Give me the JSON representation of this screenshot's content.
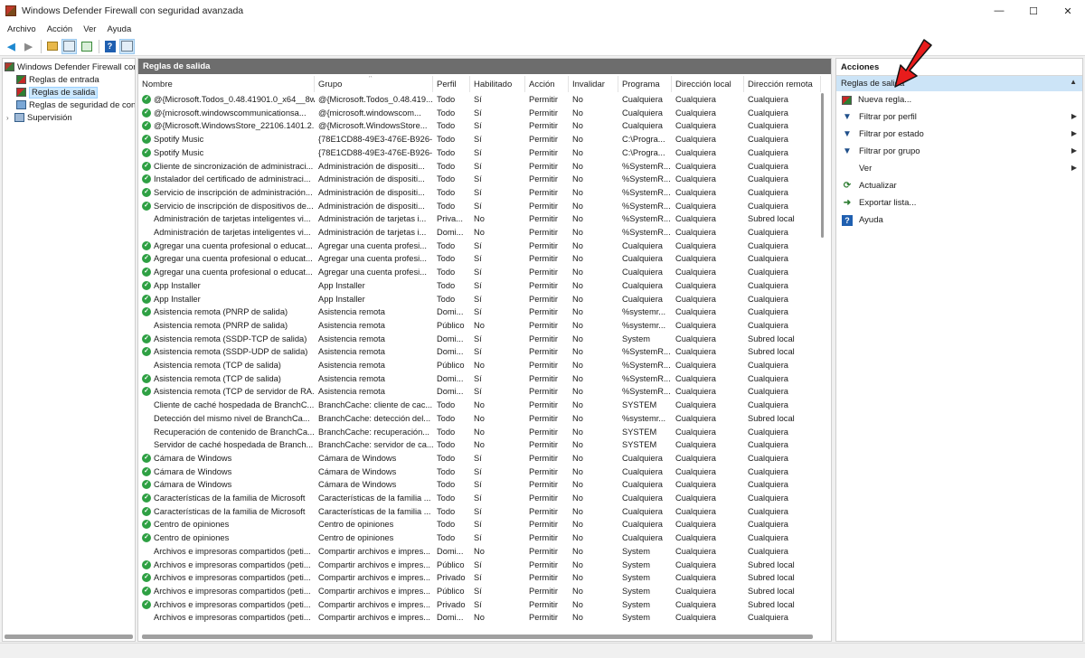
{
  "window": {
    "title": "Windows Defender Firewall con seguridad avanzada",
    "minimize": "—",
    "maximize": "☐",
    "close": "✕"
  },
  "menu": [
    "Archivo",
    "Acción",
    "Ver",
    "Ayuda"
  ],
  "tree": {
    "root": "Windows Defender Firewall con",
    "items": [
      "Reglas de entrada",
      "Reglas de salida",
      "Reglas de seguridad de con",
      "Supervisión"
    ]
  },
  "center": {
    "title": "Reglas de salida",
    "columns": [
      "Nombre",
      "Grupo",
      "Perfil",
      "Habilitado",
      "Acción",
      "Invalidar",
      "Programa",
      "Dirección local",
      "Dirección remota"
    ],
    "rows": [
      {
        "name": "@{Microsoft.Todos_0.48.41901.0_x64__8w...",
        "group": "@{Microsoft.Todos_0.48.419...",
        "profile": "Todo",
        "enabled": "Sí",
        "action": "Permitir",
        "override": "No",
        "program": "Cualquiera",
        "local": "Cualquiera",
        "remote": "Cualquiera",
        "on": true
      },
      {
        "name": "@{microsoft.windowscommunicationsa...",
        "group": "@{microsoft.windowscom...",
        "profile": "Todo",
        "enabled": "Sí",
        "action": "Permitir",
        "override": "No",
        "program": "Cualquiera",
        "local": "Cualquiera",
        "remote": "Cualquiera",
        "on": true
      },
      {
        "name": "@{Microsoft.WindowsStore_22106.1401.2...",
        "group": "@{Microsoft.WindowsStore...",
        "profile": "Todo",
        "enabled": "Sí",
        "action": "Permitir",
        "override": "No",
        "program": "Cualquiera",
        "local": "Cualquiera",
        "remote": "Cualquiera",
        "on": true
      },
      {
        "name": "Spotify Music",
        "group": "{78E1CD88-49E3-476E-B926-...",
        "profile": "Todo",
        "enabled": "Sí",
        "action": "Permitir",
        "override": "No",
        "program": "C:\\Progra...",
        "local": "Cualquiera",
        "remote": "Cualquiera",
        "on": true
      },
      {
        "name": "Spotify Music",
        "group": "{78E1CD88-49E3-476E-B926-...",
        "profile": "Todo",
        "enabled": "Sí",
        "action": "Permitir",
        "override": "No",
        "program": "C:\\Progra...",
        "local": "Cualquiera",
        "remote": "Cualquiera",
        "on": true
      },
      {
        "name": "Cliente de sincronización de administraci...",
        "group": "Administración de dispositi...",
        "profile": "Todo",
        "enabled": "Sí",
        "action": "Permitir",
        "override": "No",
        "program": "%SystemR...",
        "local": "Cualquiera",
        "remote": "Cualquiera",
        "on": true
      },
      {
        "name": "Instalador del certificado de administraci...",
        "group": "Administración de dispositi...",
        "profile": "Todo",
        "enabled": "Sí",
        "action": "Permitir",
        "override": "No",
        "program": "%SystemR...",
        "local": "Cualquiera",
        "remote": "Cualquiera",
        "on": true
      },
      {
        "name": "Servicio de inscripción de administración...",
        "group": "Administración de dispositi...",
        "profile": "Todo",
        "enabled": "Sí",
        "action": "Permitir",
        "override": "No",
        "program": "%SystemR...",
        "local": "Cualquiera",
        "remote": "Cualquiera",
        "on": true
      },
      {
        "name": "Servicio de inscripción de dispositivos de...",
        "group": "Administración de dispositi...",
        "profile": "Todo",
        "enabled": "Sí",
        "action": "Permitir",
        "override": "No",
        "program": "%SystemR...",
        "local": "Cualquiera",
        "remote": "Cualquiera",
        "on": true
      },
      {
        "name": "Administración de tarjetas inteligentes vi...",
        "group": "Administración de tarjetas i...",
        "profile": "Priva...",
        "enabled": "No",
        "action": "Permitir",
        "override": "No",
        "program": "%SystemR...",
        "local": "Cualquiera",
        "remote": "Subred local",
        "on": false
      },
      {
        "name": "Administración de tarjetas inteligentes vi...",
        "group": "Administración de tarjetas i...",
        "profile": "Domi...",
        "enabled": "No",
        "action": "Permitir",
        "override": "No",
        "program": "%SystemR...",
        "local": "Cualquiera",
        "remote": "Cualquiera",
        "on": false
      },
      {
        "name": "Agregar una cuenta profesional o educat...",
        "group": "Agregar una cuenta profesi...",
        "profile": "Todo",
        "enabled": "Sí",
        "action": "Permitir",
        "override": "No",
        "program": "Cualquiera",
        "local": "Cualquiera",
        "remote": "Cualquiera",
        "on": true
      },
      {
        "name": "Agregar una cuenta profesional o educat...",
        "group": "Agregar una cuenta profesi...",
        "profile": "Todo",
        "enabled": "Sí",
        "action": "Permitir",
        "override": "No",
        "program": "Cualquiera",
        "local": "Cualquiera",
        "remote": "Cualquiera",
        "on": true
      },
      {
        "name": "Agregar una cuenta profesional o educat...",
        "group": "Agregar una cuenta profesi...",
        "profile": "Todo",
        "enabled": "Sí",
        "action": "Permitir",
        "override": "No",
        "program": "Cualquiera",
        "local": "Cualquiera",
        "remote": "Cualquiera",
        "on": true
      },
      {
        "name": "App Installer",
        "group": "App Installer",
        "profile": "Todo",
        "enabled": "Sí",
        "action": "Permitir",
        "override": "No",
        "program": "Cualquiera",
        "local": "Cualquiera",
        "remote": "Cualquiera",
        "on": true
      },
      {
        "name": "App Installer",
        "group": "App Installer",
        "profile": "Todo",
        "enabled": "Sí",
        "action": "Permitir",
        "override": "No",
        "program": "Cualquiera",
        "local": "Cualquiera",
        "remote": "Cualquiera",
        "on": true
      },
      {
        "name": "Asistencia remota (PNRP de salida)",
        "group": "Asistencia remota",
        "profile": "Domi...",
        "enabled": "Sí",
        "action": "Permitir",
        "override": "No",
        "program": "%systemr...",
        "local": "Cualquiera",
        "remote": "Cualquiera",
        "on": true
      },
      {
        "name": "Asistencia remota (PNRP de salida)",
        "group": "Asistencia remota",
        "profile": "Público",
        "enabled": "No",
        "action": "Permitir",
        "override": "No",
        "program": "%systemr...",
        "local": "Cualquiera",
        "remote": "Cualquiera",
        "on": false
      },
      {
        "name": "Asistencia remota (SSDP-TCP de salida)",
        "group": "Asistencia remota",
        "profile": "Domi...",
        "enabled": "Sí",
        "action": "Permitir",
        "override": "No",
        "program": "System",
        "local": "Cualquiera",
        "remote": "Subred local",
        "on": true
      },
      {
        "name": "Asistencia remota (SSDP-UDP de salida)",
        "group": "Asistencia remota",
        "profile": "Domi...",
        "enabled": "Sí",
        "action": "Permitir",
        "override": "No",
        "program": "%SystemR...",
        "local": "Cualquiera",
        "remote": "Subred local",
        "on": true
      },
      {
        "name": "Asistencia remota (TCP de salida)",
        "group": "Asistencia remota",
        "profile": "Público",
        "enabled": "No",
        "action": "Permitir",
        "override": "No",
        "program": "%SystemR...",
        "local": "Cualquiera",
        "remote": "Cualquiera",
        "on": false
      },
      {
        "name": "Asistencia remota (TCP de salida)",
        "group": "Asistencia remota",
        "profile": "Domi...",
        "enabled": "Sí",
        "action": "Permitir",
        "override": "No",
        "program": "%SystemR...",
        "local": "Cualquiera",
        "remote": "Cualquiera",
        "on": true
      },
      {
        "name": "Asistencia remota (TCP de servidor de RA...",
        "group": "Asistencia remota",
        "profile": "Domi...",
        "enabled": "Sí",
        "action": "Permitir",
        "override": "No",
        "program": "%SystemR...",
        "local": "Cualquiera",
        "remote": "Cualquiera",
        "on": true
      },
      {
        "name": "Cliente de caché hospedada de BranchC...",
        "group": "BranchCache: cliente de cac...",
        "profile": "Todo",
        "enabled": "No",
        "action": "Permitir",
        "override": "No",
        "program": "SYSTEM",
        "local": "Cualquiera",
        "remote": "Cualquiera",
        "on": false
      },
      {
        "name": "Detección del mismo nivel de BranchCa...",
        "group": "BranchCache: detección del...",
        "profile": "Todo",
        "enabled": "No",
        "action": "Permitir",
        "override": "No",
        "program": "%systemr...",
        "local": "Cualquiera",
        "remote": "Subred local",
        "on": false
      },
      {
        "name": "Recuperación de contenido de BranchCa...",
        "group": "BranchCache: recuperación...",
        "profile": "Todo",
        "enabled": "No",
        "action": "Permitir",
        "override": "No",
        "program": "SYSTEM",
        "local": "Cualquiera",
        "remote": "Cualquiera",
        "on": false
      },
      {
        "name": "Servidor de caché hospedada de Branch...",
        "group": "BranchCache: servidor de ca...",
        "profile": "Todo",
        "enabled": "No",
        "action": "Permitir",
        "override": "No",
        "program": "SYSTEM",
        "local": "Cualquiera",
        "remote": "Cualquiera",
        "on": false
      },
      {
        "name": "Cámara de Windows",
        "group": "Cámara de Windows",
        "profile": "Todo",
        "enabled": "Sí",
        "action": "Permitir",
        "override": "No",
        "program": "Cualquiera",
        "local": "Cualquiera",
        "remote": "Cualquiera",
        "on": true
      },
      {
        "name": "Cámara de Windows",
        "group": "Cámara de Windows",
        "profile": "Todo",
        "enabled": "Sí",
        "action": "Permitir",
        "override": "No",
        "program": "Cualquiera",
        "local": "Cualquiera",
        "remote": "Cualquiera",
        "on": true
      },
      {
        "name": "Cámara de Windows",
        "group": "Cámara de Windows",
        "profile": "Todo",
        "enabled": "Sí",
        "action": "Permitir",
        "override": "No",
        "program": "Cualquiera",
        "local": "Cualquiera",
        "remote": "Cualquiera",
        "on": true
      },
      {
        "name": "Características de la familia de Microsoft",
        "group": "Características de la familia ...",
        "profile": "Todo",
        "enabled": "Sí",
        "action": "Permitir",
        "override": "No",
        "program": "Cualquiera",
        "local": "Cualquiera",
        "remote": "Cualquiera",
        "on": true
      },
      {
        "name": "Características de la familia de Microsoft",
        "group": "Características de la familia ...",
        "profile": "Todo",
        "enabled": "Sí",
        "action": "Permitir",
        "override": "No",
        "program": "Cualquiera",
        "local": "Cualquiera",
        "remote": "Cualquiera",
        "on": true
      },
      {
        "name": "Centro de opiniones",
        "group": "Centro de opiniones",
        "profile": "Todo",
        "enabled": "Sí",
        "action": "Permitir",
        "override": "No",
        "program": "Cualquiera",
        "local": "Cualquiera",
        "remote": "Cualquiera",
        "on": true
      },
      {
        "name": "Centro de opiniones",
        "group": "Centro de opiniones",
        "profile": "Todo",
        "enabled": "Sí",
        "action": "Permitir",
        "override": "No",
        "program": "Cualquiera",
        "local": "Cualquiera",
        "remote": "Cualquiera",
        "on": true
      },
      {
        "name": "Archivos e impresoras compartidos (peti...",
        "group": "Compartir archivos e impres...",
        "profile": "Domi...",
        "enabled": "No",
        "action": "Permitir",
        "override": "No",
        "program": "System",
        "local": "Cualquiera",
        "remote": "Cualquiera",
        "on": false
      },
      {
        "name": "Archivos e impresoras compartidos (peti...",
        "group": "Compartir archivos e impres...",
        "profile": "Público",
        "enabled": "Sí",
        "action": "Permitir",
        "override": "No",
        "program": "System",
        "local": "Cualquiera",
        "remote": "Subred local",
        "on": true
      },
      {
        "name": "Archivos e impresoras compartidos (peti...",
        "group": "Compartir archivos e impres...",
        "profile": "Privado",
        "enabled": "Sí",
        "action": "Permitir",
        "override": "No",
        "program": "System",
        "local": "Cualquiera",
        "remote": "Subred local",
        "on": true
      },
      {
        "name": "Archivos e impresoras compartidos (peti...",
        "group": "Compartir archivos e impres...",
        "profile": "Público",
        "enabled": "Sí",
        "action": "Permitir",
        "override": "No",
        "program": "System",
        "local": "Cualquiera",
        "remote": "Subred local",
        "on": true
      },
      {
        "name": "Archivos e impresoras compartidos (peti...",
        "group": "Compartir archivos e impres...",
        "profile": "Privado",
        "enabled": "Sí",
        "action": "Permitir",
        "override": "No",
        "program": "System",
        "local": "Cualquiera",
        "remote": "Subred local",
        "on": true
      },
      {
        "name": "Archivos e impresoras compartidos (peti...",
        "group": "Compartir archivos e impres...",
        "profile": "Domi...",
        "enabled": "No",
        "action": "Permitir",
        "override": "No",
        "program": "System",
        "local": "Cualquiera",
        "remote": "Cualquiera",
        "on": false
      }
    ]
  },
  "actions": {
    "title": "Acciones",
    "section": "Reglas de salida",
    "items": [
      {
        "label": "Nueva regla...",
        "icon": "new-rule-icon",
        "submenu": false
      },
      {
        "label": "Filtrar por perfil",
        "icon": "filter-icon",
        "submenu": true
      },
      {
        "label": "Filtrar por estado",
        "icon": "filter-icon",
        "submenu": true
      },
      {
        "label": "Filtrar por grupo",
        "icon": "filter-icon",
        "submenu": true
      },
      {
        "label": "Ver",
        "icon": "",
        "submenu": true
      },
      {
        "label": "Actualizar",
        "icon": "refresh-icon",
        "submenu": false
      },
      {
        "label": "Exportar lista...",
        "icon": "export-icon",
        "submenu": false
      },
      {
        "label": "Ayuda",
        "icon": "help-icon",
        "submenu": false
      }
    ]
  },
  "colors": {
    "accent": "#cce4f7",
    "pane_header": "#6d6d6d",
    "enabled_check": "#2ea043",
    "annotation_arrow": "#e81c1c"
  }
}
